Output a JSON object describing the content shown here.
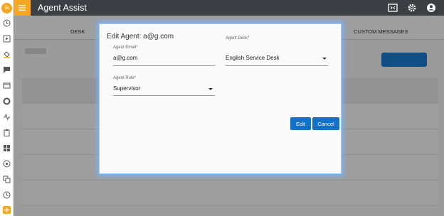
{
  "app": {
    "title": "Agent Assist",
    "logo_text": "ia"
  },
  "topbar": {
    "menu_icon": "hamburger-menu-icon",
    "right_icons": [
      "screen-icon",
      "gear-icon",
      "user-account-icon"
    ]
  },
  "sidebar": {
    "icons": [
      "logo",
      "clock-icon",
      "play-icon",
      "bucket-icon",
      "chat-icon",
      "window-icon",
      "circle-icon",
      "pulse-icon",
      "clipboard-icon",
      "grid-icon",
      "settings-circle-icon",
      "translate-icon",
      "history-icon",
      "add-icon"
    ]
  },
  "background_tabs": {
    "desk": "DESK",
    "custom_messages": "CUSTOM MESSAGES"
  },
  "modal": {
    "title": "Edit Agent: a@g.com",
    "email_label": "Agent Email*",
    "email_value": "a@g.com",
    "role_label": "Agent Role*",
    "role_value": "Supervisor",
    "desk_label": "Agent Desk*",
    "desk_value": "English Service Desk",
    "edit_button": "Edit",
    "cancel_button": "Cancel"
  },
  "colors": {
    "accent": "#f5a623",
    "topbar": "#3b3f44",
    "primary_button": "#1272c9",
    "modal_glow": "#9ecbff"
  }
}
